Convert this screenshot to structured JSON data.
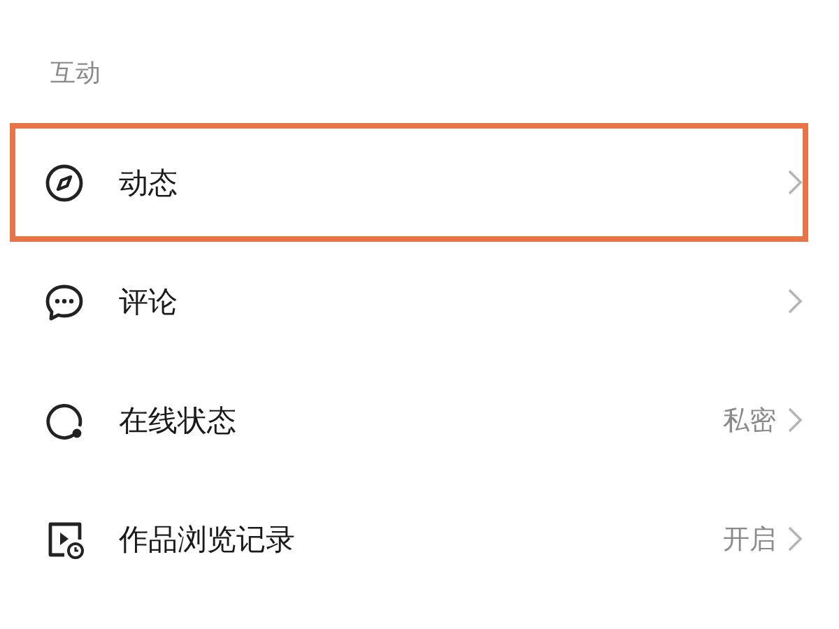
{
  "section": {
    "title": "互动"
  },
  "items": [
    {
      "label": "动态",
      "highlighted": true
    },
    {
      "label": "评论",
      "highlighted": false
    },
    {
      "label": "在线状态",
      "value": "私密",
      "highlighted": false
    },
    {
      "label": "作品浏览记录",
      "value": "开启",
      "highlighted": false
    }
  ]
}
